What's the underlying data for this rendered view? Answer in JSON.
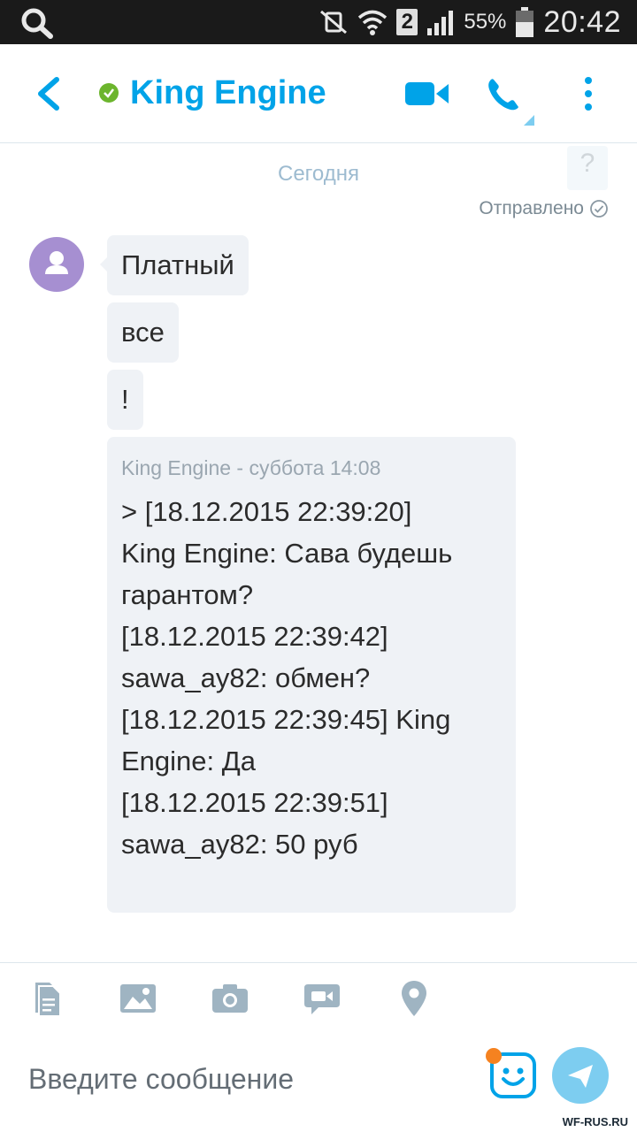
{
  "status_bar": {
    "battery_percent": "55%",
    "sim_badge": "2",
    "time": "20:42"
  },
  "header": {
    "contact_name": "King Engine",
    "presence_color": "#6cb52d",
    "accent_color": "#00a3e8"
  },
  "chat": {
    "help_glyph": "?",
    "date_label": "Сегодня",
    "sent_status": "Отправлено",
    "messages": [
      {
        "text": "Платный"
      },
      {
        "text": "все"
      },
      {
        "text": "!"
      }
    ],
    "quote": {
      "meta": "King Engine - суббота 14:08",
      "lines": [
        "> [18.12.2015 22:39:20]",
        "King Engine: Сава будешь",
        "гарантом?",
        "[18.12.2015 22:39:42]",
        "sawa_ay82: обмен?",
        "[18.12.2015 22:39:45] King",
        "Engine: Да",
        "[18.12.2015 22:39:51]",
        "sawa_ay82: 50 руб"
      ]
    }
  },
  "toolbar": {
    "icons": [
      "file-icon",
      "gallery-icon",
      "camera-icon",
      "video-message-icon",
      "location-icon"
    ]
  },
  "input": {
    "placeholder": "Введите сообщение"
  },
  "watermark": "WF-RUS.RU"
}
